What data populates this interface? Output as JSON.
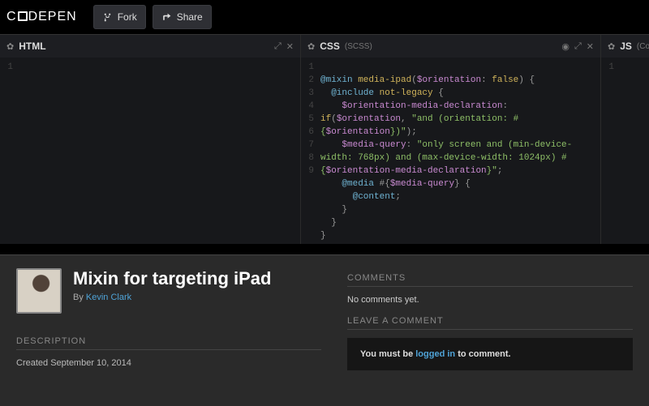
{
  "topbar": {
    "logo_left": "C",
    "logo_right": "DEPEN",
    "fork_label": "Fork",
    "share_label": "Share"
  },
  "panels": {
    "html": {
      "label": "HTML"
    },
    "css": {
      "label": "CSS",
      "sub": "(SCSS)"
    },
    "js": {
      "label": "JS",
      "sub": "(Coffee"
    }
  },
  "code": {
    "lines": [
      "1",
      "2",
      "3",
      "4",
      "5",
      "6",
      "7",
      "8",
      "9"
    ],
    "l1_a": "@mixin",
    "l1_b": " media-ipad",
    "l1_c": "(",
    "l1_d": "$orientation",
    "l1_e": ": ",
    "l1_f": "false",
    "l1_g": ") {",
    "l2_a": "@include",
    "l2_b": " not-legacy ",
    "l2_c": "{",
    "l3_a": "$orientation-media-declaration",
    "l3_b": ": ",
    "l3_c": "if",
    "l3_d": "(",
    "l3_e": "$orientation",
    "l3_f": ", ",
    "l3_g": "\"and (orientation: #{",
    "l3_h": "$orientation",
    "l3_i": "})\"",
    "l3_j": ");",
    "l4_a": "$media-query",
    "l4_b": ": ",
    "l4_c": "\"only screen and (min-device-width: 768px) and (max-device-width: 1024px) #{",
    "l4_d": "$orientation-media-declaration",
    "l4_e": "}\"",
    "l4_f": ";",
    "l5_a": "@media",
    "l5_b": " #{",
    "l5_c": "$media-query",
    "l5_d": "} ",
    "l5_e": "{",
    "l6_a": "@content",
    "l6_b": ";",
    "l7": "}",
    "l8": "}",
    "l9": "}"
  },
  "details": {
    "title": "Mixin for targeting iPad",
    "by_prefix": "By ",
    "author": "Kevin Clark",
    "desc_label": "DESCRIPTION",
    "desc_text": "Created September 10, 2014",
    "comments_label": "COMMENTS",
    "comments_empty": "No comments yet.",
    "leave_label": "LEAVE A COMMENT",
    "login_before": "You must be ",
    "login_link": "logged in",
    "login_after": " to comment."
  }
}
